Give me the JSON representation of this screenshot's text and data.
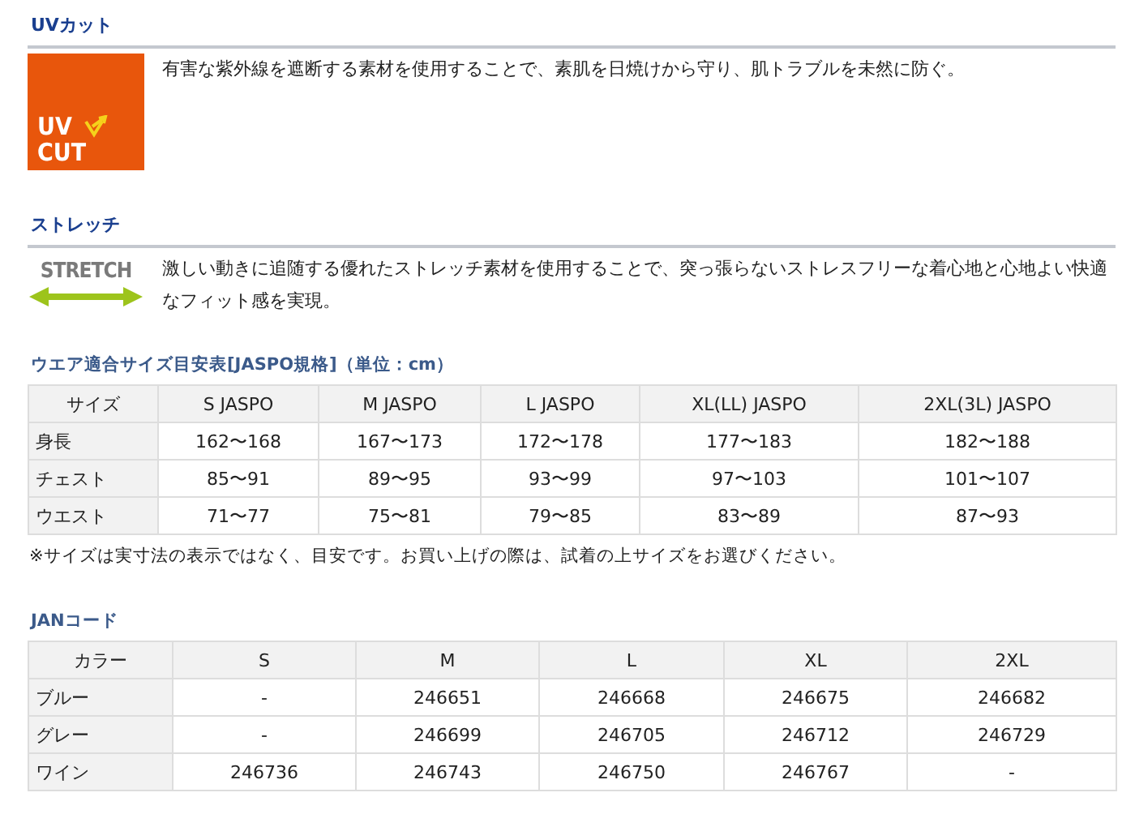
{
  "features": [
    {
      "kind": "uv",
      "title": "UVカット",
      "logo_lines": [
        "UV",
        "CUT"
      ],
      "text": "有害な紫外線を遮断する素材を使用することで、素肌を日焼けから守り、肌トラブルを未然に防ぐ。"
    },
    {
      "kind": "stretch",
      "title": "ストレッチ",
      "logo_lines": [
        "STRETCH"
      ],
      "text": "激しい動きに追随する優れたストレッチ素材を使用することで、突っ張らないストレスフリーな着心地と心地よい快適なフィット感を実現。"
    }
  ],
  "size_table": {
    "title": "ウエア適合サイズ目安表[JASPO規格]（単位：cm）",
    "columns": [
      "サイズ",
      "S JASPO",
      "M JASPO",
      "L JASPO",
      "XL(LL) JASPO",
      "2XL(3L) JASPO"
    ],
    "rows": [
      [
        "身長",
        "162〜168",
        "167〜173",
        "172〜178",
        "177〜183",
        "182〜188"
      ],
      [
        "チェスト",
        "85〜91",
        "89〜95",
        "93〜99",
        "97〜103",
        "101〜107"
      ],
      [
        "ウエスト",
        "71〜77",
        "75〜81",
        "79〜85",
        "83〜89",
        "87〜93"
      ]
    ],
    "note": "※サイズは実寸法の表示ではなく、目安です。お買い上げの際は、試着の上サイズをお選びください。"
  },
  "jan_table": {
    "title": "JANコード",
    "columns": [
      "カラー",
      "S",
      "M",
      "L",
      "XL",
      "2XL"
    ],
    "rows": [
      [
        "ブルー",
        "-",
        "246651",
        "246668",
        "246675",
        "246682"
      ],
      [
        "グレー",
        "-",
        "246699",
        "246705",
        "246712",
        "246729"
      ],
      [
        "ワイン",
        "246736",
        "246743",
        "246750",
        "246767",
        "-"
      ]
    ]
  }
}
